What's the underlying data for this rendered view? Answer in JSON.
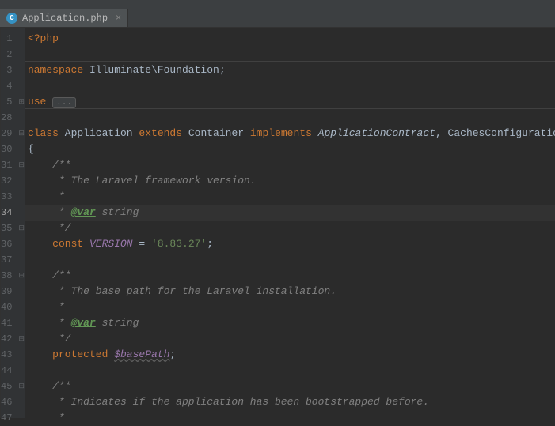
{
  "tab": {
    "icon_letter": "C",
    "filename": "Application.php"
  },
  "line_numbers": [
    1,
    2,
    3,
    4,
    5,
    28,
    29,
    30,
    31,
    32,
    33,
    34,
    35,
    36,
    37,
    38,
    39,
    40,
    41,
    42,
    43,
    44,
    45,
    46,
    47
  ],
  "active_line": 34,
  "fold_placeholder": "...",
  "code": {
    "l1": "<?php",
    "l3_ns": "namespace",
    "l3_val": "Illuminate\\Foundation",
    "l5_use": "use",
    "l29_class": "class",
    "l29_name": "Application",
    "l29_ext": "extends",
    "l29_parent": "Container",
    "l29_impl": "implements",
    "l29_i1": "ApplicationContract",
    "l29_i2": "CachesConfiguration",
    "l30": "{",
    "l31": "    /**",
    "l32": "     * The Laravel framework version.",
    "l33": "     *",
    "l34_pre": "     * ",
    "l34_tag": "@var",
    "l34_type": " string",
    "l35": "     */",
    "l36_const": "const",
    "l36_name": "VERSION",
    "l36_eq": " = ",
    "l36_val": "'8.83.27'",
    "l38": "    /**",
    "l39": "     * The base path for the Laravel installation.",
    "l40": "     *",
    "l41_pre": "     * ",
    "l41_tag": "@var",
    "l41_type": " string",
    "l42": "     */",
    "l43_prot": "protected",
    "l43_var": "$basePath",
    "l45": "    /**",
    "l46": "     * Indicates if the application has been bootstrapped before.",
    "l47": "     *"
  }
}
